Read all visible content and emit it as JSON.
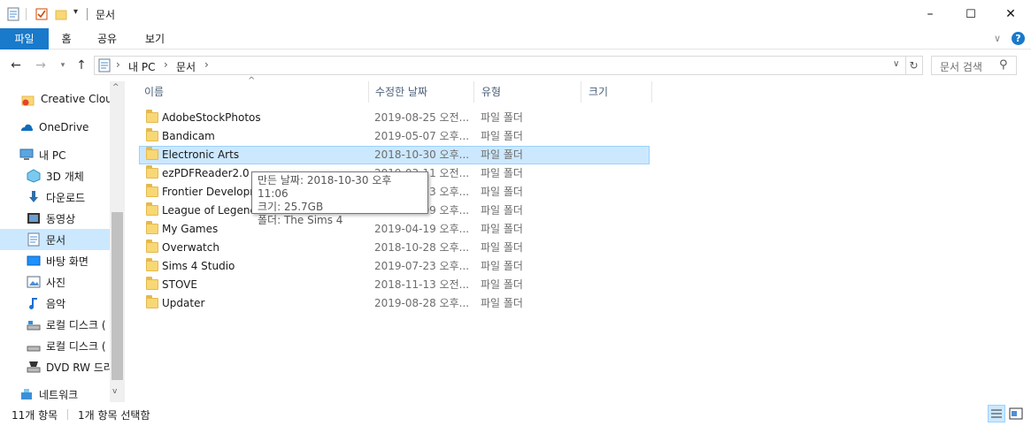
{
  "window": {
    "title": "문서",
    "minimize": "–",
    "maximize": "☐",
    "close": "✕"
  },
  "ribbon": {
    "tabs": [
      {
        "label": "파일"
      },
      {
        "label": "홈"
      },
      {
        "label": "공유"
      },
      {
        "label": "보기"
      }
    ],
    "expand": "∨",
    "help": "?"
  },
  "address": {
    "path": [
      "내 PC",
      "문서"
    ],
    "search_placeholder": "문서 검색"
  },
  "nav": {
    "items": [
      {
        "label": "Creative Cloud",
        "icon": "creative-cloud-icon"
      },
      {
        "label": "OneDrive",
        "icon": "onedrive-icon"
      },
      {
        "label": "내 PC",
        "icon": "this-pc-icon"
      },
      {
        "label": "3D 개체",
        "icon": "3d-objects-icon"
      },
      {
        "label": "다운로드",
        "icon": "download-icon"
      },
      {
        "label": "동영상",
        "icon": "video-icon"
      },
      {
        "label": "문서",
        "icon": "documents-icon"
      },
      {
        "label": "바탕 화면",
        "icon": "desktop-icon"
      },
      {
        "label": "사진",
        "icon": "pictures-icon"
      },
      {
        "label": "음악",
        "icon": "music-icon"
      },
      {
        "label": "로컬 디스크 (",
        "icon": "drive-icon"
      },
      {
        "label": "로컬 디스크 (",
        "icon": "drive-icon"
      },
      {
        "label": "DVD RW 드라",
        "icon": "dvd-icon"
      },
      {
        "label": "네트워크",
        "icon": "network-icon"
      }
    ]
  },
  "columns": {
    "name": "이름",
    "date": "수정한 날짜",
    "type": "유형",
    "size": "크기"
  },
  "files": [
    {
      "name": "AdobeStockPhotos",
      "date": "2019-08-25 오전...",
      "type": "파일 폴더"
    },
    {
      "name": "Bandicam",
      "date": "2019-05-07 오후...",
      "type": "파일 폴더"
    },
    {
      "name": "Electronic Arts",
      "date": "2018-10-30 오후...",
      "type": "파일 폴더"
    },
    {
      "name": "ezPDFReader2.0",
      "date": "2019-03-11 오전...",
      "type": "파일 폴더"
    },
    {
      "name": "Frontier Developments",
      "date": "2019-05-23 오후...",
      "type": "파일 폴더"
    },
    {
      "name": "League of Legends",
      "date": "2019-07-09 오후...",
      "type": "파일 폴더"
    },
    {
      "name": "My Games",
      "date": "2019-04-19 오후...",
      "type": "파일 폴더"
    },
    {
      "name": "Overwatch",
      "date": "2018-10-28 오후...",
      "type": "파일 폴더"
    },
    {
      "name": "Sims 4 Studio",
      "date": "2019-07-23 오후...",
      "type": "파일 폴더"
    },
    {
      "name": "STOVE",
      "date": "2018-11-13 오전...",
      "type": "파일 폴더"
    },
    {
      "name": "Updater",
      "date": "2019-08-28 오후...",
      "type": "파일 폴더"
    }
  ],
  "tooltip": {
    "line1": "만든 날짜: 2018-10-30 오후 11:06",
    "line2": "크기: 25.7GB",
    "line3": "폴더: The Sims 4"
  },
  "status": {
    "count": "11개 항목",
    "selected": "1개 항목 선택함"
  },
  "colors": {
    "accent": "#1979ca",
    "selection": "#cce8ff",
    "folder": "#f8d775"
  }
}
